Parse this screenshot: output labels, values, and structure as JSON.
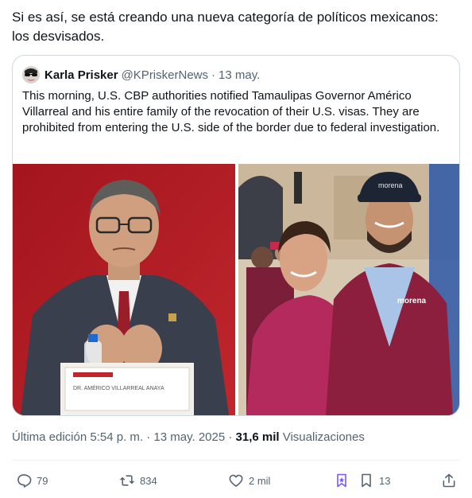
{
  "tweet": {
    "text_line1": "Si es así, se está creando una nueva categoría de políticos mexicanos:",
    "text_line2": "los desvisados."
  },
  "quote": {
    "name": "Karla Prisker",
    "handle": "@KPriskerNews",
    "date": "13 may.",
    "body": "This morning, U.S. CBP authorities notified Tamaulipas Governor Américo Villarreal and his entire family of the revocation of their U.S. visas. They are prohibited from entering the U.S. side of the border due to federal investigation.",
    "podium_label": "DR. AMÉRICO VILLARREAL ANAYA",
    "vest_label": "morena"
  },
  "meta": {
    "edited": "Última edición 5:54 p. m. · 13 may. 2025 · ",
    "views_count": "31,6 mil",
    "views_label": " Visualizaciones"
  },
  "actions": {
    "replies": "79",
    "reposts": "834",
    "likes": "2 mil",
    "bookmarks": "13"
  },
  "icons": [
    "reply-icon",
    "repost-icon",
    "like-icon",
    "grok-icon",
    "bookmark-icon",
    "share-icon"
  ],
  "colors": {
    "text": "#0f1419",
    "secondary": "#536471",
    "border": "#cfd9de",
    "grok_accent": "#7856ff"
  }
}
